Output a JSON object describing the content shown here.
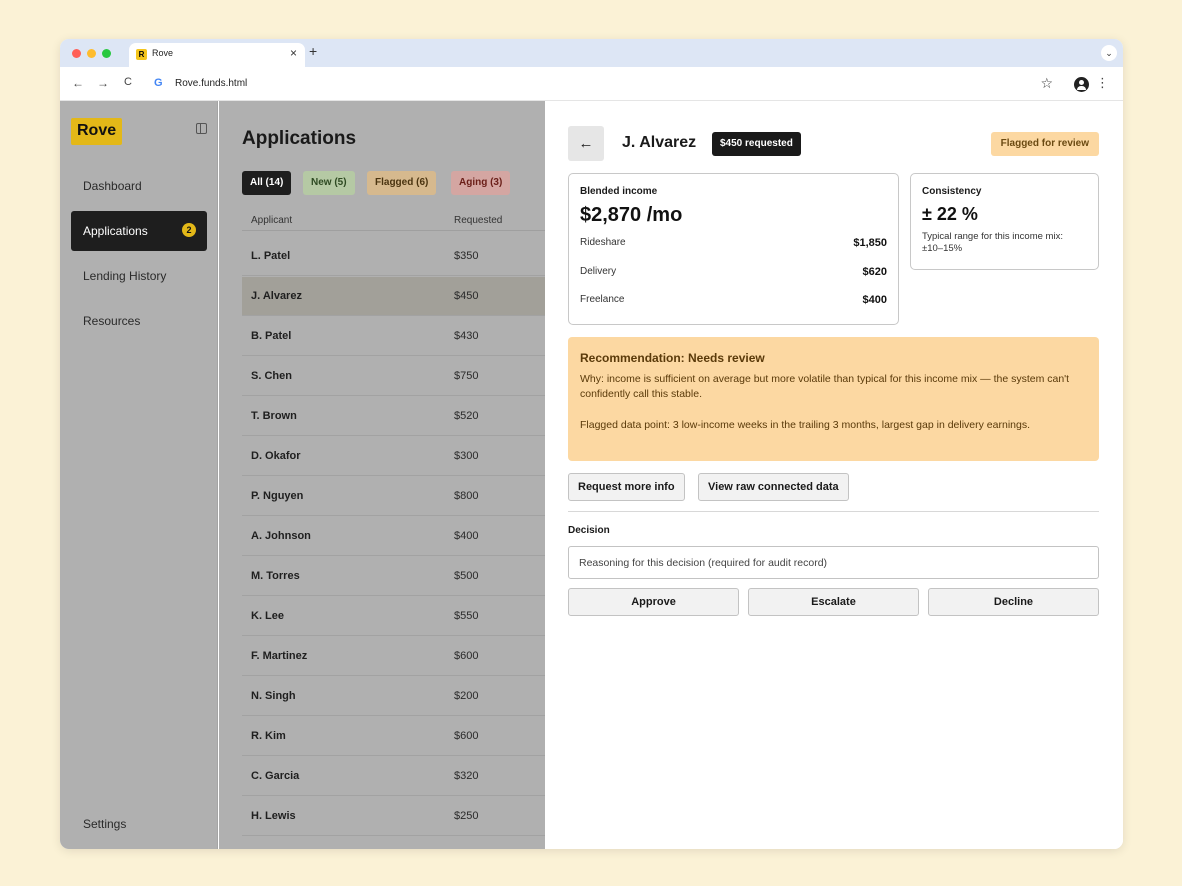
{
  "browser": {
    "tab_title": "Rove",
    "favicon_letter": "R",
    "tab_close": "×",
    "new_tab": "+",
    "tab_menu": "⌄",
    "url": "Rove.funds.html",
    "url_logo": "G",
    "back": "←",
    "forward": "→",
    "reload": "C",
    "star": "☆",
    "menu": "⋮",
    "traffic_colors": [
      "#ff5f57",
      "#febc2e",
      "#28c840"
    ]
  },
  "sidebar": {
    "logo": "Rove",
    "items": [
      {
        "label": "Dashboard"
      },
      {
        "label": "Applications",
        "badge": "2"
      },
      {
        "label": "Lending History"
      },
      {
        "label": "Resources"
      }
    ],
    "settings": "Settings"
  },
  "list": {
    "title": "Applications",
    "filters": [
      {
        "label": "All (14)",
        "bg": "#1e1e1e",
        "fg": "#ffffff"
      },
      {
        "label": "New (5)",
        "bg": "#b5c9a4",
        "fg": "#2e4a22"
      },
      {
        "label": "Flagged (6)",
        "bg": "#d6b98e",
        "fg": "#4a3410"
      },
      {
        "label": "Aging (3)",
        "bg": "#d4a6a2",
        "fg": "#6a1e18"
      }
    ],
    "columns": [
      "Applicant",
      "Requested"
    ],
    "rows": [
      {
        "name": "L. Patel",
        "amount": "$350"
      },
      {
        "name": "J. Alvarez",
        "amount": "$450"
      },
      {
        "name": "B. Patel",
        "amount": "$430"
      },
      {
        "name": "S. Chen",
        "amount": "$750"
      },
      {
        "name": "T. Brown",
        "amount": "$520"
      },
      {
        "name": "D. Okafor",
        "amount": "$300"
      },
      {
        "name": "P. Nguyen",
        "amount": "$800"
      },
      {
        "name": "A. Johnson",
        "amount": "$400"
      },
      {
        "name": "M. Torres",
        "amount": "$500"
      },
      {
        "name": "K. Lee",
        "amount": "$550"
      },
      {
        "name": "F. Martinez",
        "amount": "$600"
      },
      {
        "name": "N. Singh",
        "amount": "$200"
      },
      {
        "name": "R. Kim",
        "amount": "$600"
      },
      {
        "name": "C. Garcia",
        "amount": "$320"
      },
      {
        "name": "H. Lewis",
        "amount": "$250"
      }
    ]
  },
  "detail": {
    "back_icon": "←",
    "name": "J. Alvarez",
    "requested": "$450 requested",
    "flag": "Flagged for review",
    "income": {
      "label": "Blended income",
      "value": "$2,870 /mo",
      "lines": [
        {
          "label": "Rideshare",
          "value": "$1,850"
        },
        {
          "label": "Delivery",
          "value": "$620"
        },
        {
          "label": "Freelance",
          "value": "$400"
        }
      ]
    },
    "consistency": {
      "label": "Consistency",
      "value": "± 22 %",
      "note": "Typical range for this income mix: ±10–15%"
    },
    "recommendation": {
      "title": "Recommendation: Needs review",
      "why": "Why: income is sufficient on average but more volatile than typical for this income mix — the system can't confidently call this stable.",
      "flagged": "Flagged data point: 3 low-income weeks in the trailing 3 months, largest gap in delivery earnings."
    },
    "actions": {
      "request_info": "Request more info",
      "view_raw": "View raw connected data"
    },
    "decision": {
      "label": "Decision",
      "placeholder": "Reasoning for this decision (required for audit record)",
      "approve": "Approve",
      "escalate": "Escalate",
      "decline": "Decline"
    }
  }
}
